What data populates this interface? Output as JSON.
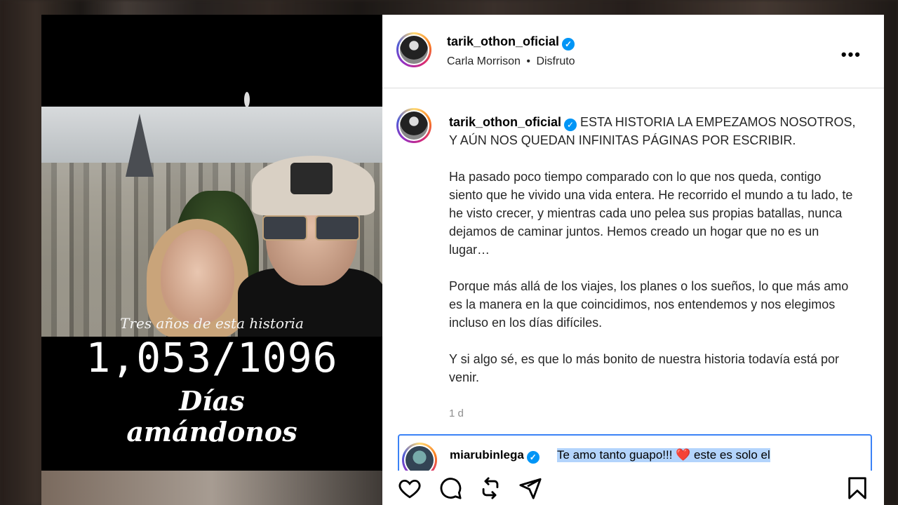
{
  "post": {
    "header": {
      "username": "tarik_othon_oficial",
      "audio_artist": "Carla Morrison",
      "separator": "•",
      "audio_title": "Disfruto",
      "more_label": "•••"
    },
    "media": {
      "overlay_title": "Tres años de esta historia",
      "counter": "1,053/1096",
      "line1": "Días",
      "line2": "amándonos"
    },
    "caption": {
      "username": "tarik_othon_oficial",
      "paragraphs": [
        "ESTA HISTORIA LA EMPEZAMOS NOSOTROS, Y AÚN NOS QUEDAN INFINITAS PÁGINAS POR ESCRIBIR.",
        "Ha pasado poco tiempo comparado con lo que nos queda, contigo siento que he vivido una vida entera. He recorrido el mundo a tu lado, te he visto crecer, y mientras cada uno pelea sus propias batallas, nunca dejamos de caminar juntos. Hemos creado un hogar que no es un lugar…",
        "Porque más allá de los viajes, los planes o los sueños, lo que más amo es la manera en la que coincidimos, nos entendemos y nos elegimos incluso en los días difíciles.",
        "Y si algo sé, es que lo más bonito de nuestra historia todavía está por venir."
      ],
      "time": "1 d"
    },
    "comment": {
      "username": "miarubinlega",
      "text": "Te amo tanto guapo!!! ❤️ este es solo el"
    }
  },
  "icons": {
    "like": "heart-icon",
    "comment": "comment-icon",
    "repost": "repost-icon",
    "share": "share-icon",
    "save": "bookmark-icon"
  },
  "colors": {
    "verified": "#0095f6",
    "selection": "#b3d4fc",
    "focus_border": "#3b82f6"
  }
}
